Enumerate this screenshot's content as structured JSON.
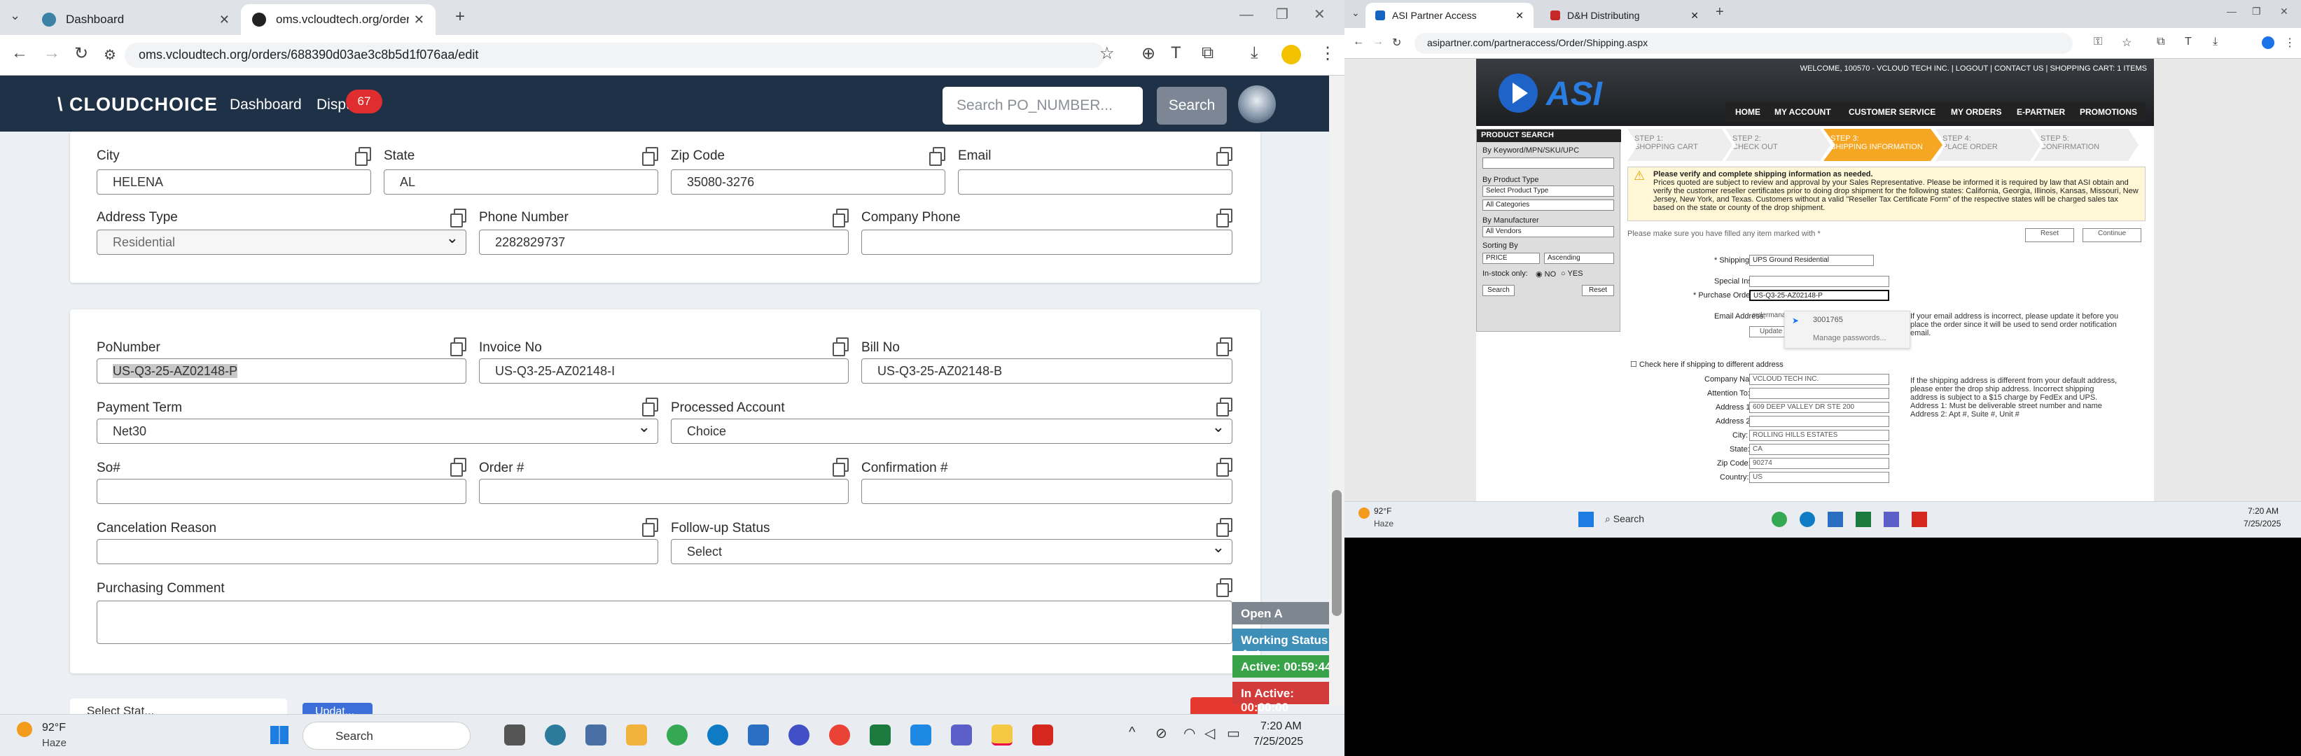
{
  "left_browser": {
    "tabs": [
      {
        "label": "Dashboard",
        "active": false
      },
      {
        "label": "oms.vcloudtech.org/orders/68...",
        "active": true
      }
    ],
    "url": "oms.vcloudtech.org/orders/688390d03ae3c8b5d1f076aa/edit",
    "app": {
      "logo": "\\ CLOUDCHOICE",
      "nav_dashboard": "Dashboard",
      "nav_disputes": "Dispu",
      "disputes_count": "67",
      "search_placeholder": "Search PO_NUMBER...",
      "search_button": "Search"
    },
    "address": {
      "city_label": "City",
      "city": "HELENA",
      "state_label": "State",
      "state": "AL",
      "zip_label": "Zip Code",
      "zip": "35080-3276",
      "email_label": "Email",
      "email": "",
      "address_type_label": "Address Type",
      "address_type": "Residential",
      "phone_label": "Phone Number",
      "phone": "2282829737",
      "company_phone_label": "Company Phone",
      "company_phone": ""
    },
    "order": {
      "po_label": "PoNumber",
      "po": "US-Q3-25-AZ02148-P",
      "invoice_label": "Invoice No",
      "invoice": "US-Q3-25-AZ02148-I",
      "bill_label": "Bill No",
      "bill": "US-Q3-25-AZ02148-B",
      "payment_label": "Payment Term",
      "payment": "Net30",
      "processed_label": "Processed Account",
      "processed": "Choice",
      "so_label": "So#",
      "so": "",
      "order_no_label": "Order #",
      "order_no": "",
      "confirmation_label": "Confirmation #",
      "confirmation": "",
      "cancel_label": "Cancelation Reason",
      "cancel": "",
      "followup_label": "Follow-up Status",
      "followup": "Select",
      "comment_label": "Purchasing Comment",
      "comment": ""
    },
    "bottom": {
      "select_status": "Select Stat...",
      "update": "Updat..."
    },
    "status_panel": {
      "open": "Open A",
      "working": "Working Status: Act",
      "active": "Active: 00:59:44",
      "inactive": "In Active: 00:00:00"
    },
    "taskbar": {
      "temp": "92°F",
      "weather": "Haze",
      "search": "Search",
      "time": "7:20 AM",
      "date": "7/25/2025"
    }
  },
  "right_browser": {
    "tabs": [
      {
        "label": "ASI Partner Access"
      },
      {
        "label": "D&H Distributing"
      }
    ],
    "url": "asipartner.com/partneraccess/Order/Shipping.aspx",
    "top_links": "WELCOME, 100570 - VCLOUD TECH INC. | LOGOUT | CONTACT US | SHOPPING CART: 1 ITEMS",
    "menu": [
      "HOME",
      "MY ACCOUNT",
      "CUSTOMER SERVICE",
      "MY ORDERS",
      "E-PARTNER",
      "PROMOTIONS"
    ],
    "product_search": {
      "title": "PRODUCT SEARCH",
      "by_keyword": "By Keyword/MPN/SKU/UPC",
      "by_type": "By Product Type",
      "type_select": "Select Product Type",
      "all_categories": "All Categories",
      "by_manufacturer": "By Manufacturer",
      "all_vendors": "All Vendors",
      "sorting": "Sorting By",
      "sort_by": "PRICE",
      "sort_dir": "Ascending",
      "in_stock": "In-stock only:",
      "no": "NO",
      "yes": "YES",
      "search": "Search",
      "reset": "Reset"
    },
    "steps": [
      {
        "n": "STEP 1:",
        "t": "SHOPPING CART"
      },
      {
        "n": "STEP 2:",
        "t": "CHECK OUT"
      },
      {
        "n": "STEP 3:",
        "t": "SHIPPING INFORMATION"
      },
      {
        "n": "STEP 4:",
        "t": "PLACE ORDER"
      },
      {
        "n": "STEP 5:",
        "t": "CONFIRMATION"
      }
    ],
    "notice_title": "Please verify and complete shipping information as needed.",
    "notice_body": "Prices quoted are subject to review and approval by your Sales Representative. Please be informed it is required by law that ASI obtain and verify the customer reseller certificates prior to doing drop shipment for the following states: California, Georgia, Illinois, Kansas, Missouri, New Jersey, New York, and Texas. Customers without a valid \"Reseller Tax Certificate Form\" of the respective states will be charged sales tax based on the state or county of the drop shipment.",
    "required_note": "Please make sure you have filled any item marked with *",
    "reset": "Reset",
    "continue": "Continue",
    "shipping_type_label": "* Shipping Type:",
    "shipping_type": "UPS Ground Residential",
    "special_label": "Special Instruction",
    "po_label": "* Purchase Order Number:",
    "po": "US-Q3-25-AZ02148-P",
    "email_label": "Email Address:",
    "email": "ordermanageme...",
    "update_email": "Update Email",
    "autofill": "3001765",
    "manage_passwords": "Manage passwords...",
    "email_note": "If your email address is incorrect, please update it before you place the order since it will be used to send order notification email.",
    "diff_check": "Check here if shipping to different address",
    "company_label": "Company Name:",
    "company": "VCLOUD TECH INC.",
    "attention_label": "Attention To:",
    "addr1_label": "Address 1:",
    "addr1": "609 DEEP VALLEY DR STE 200",
    "addr2_label": "Address 2:",
    "city_label": "City:",
    "city": "ROLLING HILLS ESTATES",
    "state_label": "State:",
    "state": "CA",
    "zip_label": "Zip Code:",
    "zip": "90274",
    "country_label": "Country:",
    "country": "US",
    "addr_note": "If the shipping address is different from your default address, please enter the drop ship address. Incorrect shipping address is subject to a $15 charge by FedEx and UPS. Address 1: Must be deliverable street number and name Address 2: Apt #, Suite #, Unit #",
    "taskbar": {
      "temp": "92°F",
      "weather": "Haze",
      "search": "Search",
      "time": "7:20 AM",
      "date": "7/25/2025"
    }
  }
}
